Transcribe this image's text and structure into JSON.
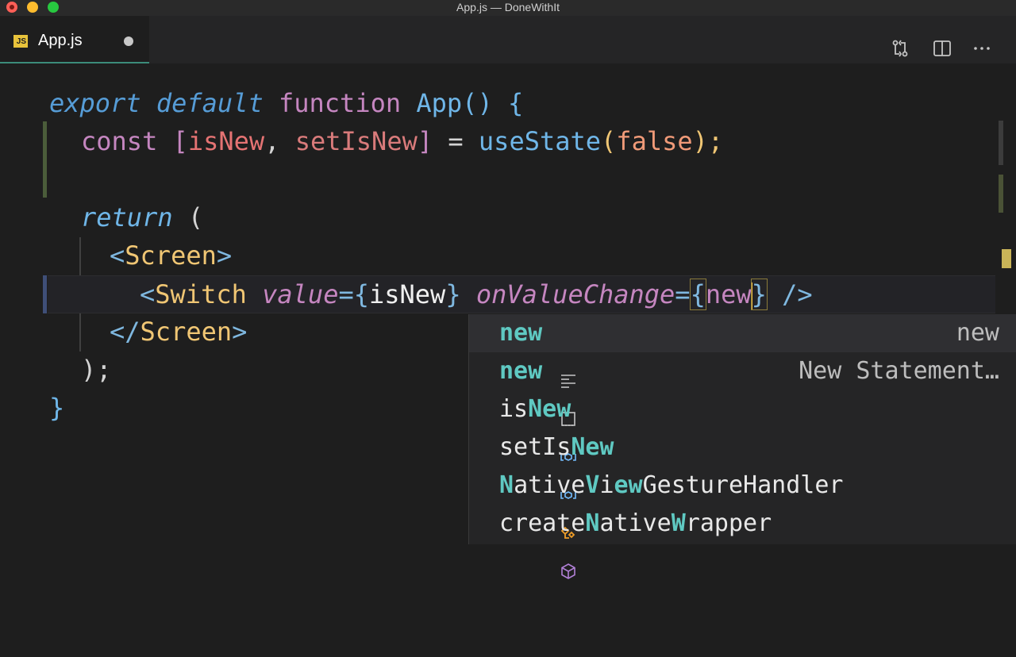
{
  "window": {
    "title": "App.js — DoneWithIt"
  },
  "tab": {
    "icon_label": "JS",
    "name": "App.js"
  },
  "toolbar_icons": [
    "source-control-compare-icon",
    "split-editor-icon",
    "more-actions-icon"
  ],
  "code": {
    "l1": {
      "export": "export",
      "default": "default",
      "function": "function",
      "name": "App",
      "rest": "() {"
    },
    "l2": {
      "const": "const",
      "open": "[",
      "a": "isNew",
      "comma": ", ",
      "b": "setIsNew",
      "close": "]",
      "eq": " = ",
      "call": "useState",
      "p1": "(",
      "val": "false",
      "p2": ");"
    },
    "l4": {
      "return": "return",
      "rest": " ("
    },
    "l5": {
      "lt": "<",
      "tag": "Screen",
      "gt": ">"
    },
    "l6": {
      "lt": "<",
      "tag": "Switch",
      "attr1": "value",
      "eq1": "=",
      "ob1": "{",
      "v1": "isNew",
      "cb1": "}",
      "attr2": "onValueChange",
      "eq2": "=",
      "ob2": "{",
      "v2": "new",
      "cb2": "}",
      "end": " />"
    },
    "l7": {
      "lt": "</",
      "tag": "Screen",
      "gt": ">"
    },
    "l8": {
      "text": ");"
    },
    "l9": {
      "text": "}"
    }
  },
  "suggestions": [
    {
      "icon": "snippet-text-icon",
      "pre": "",
      "match": "new",
      "post": "",
      "detail": "new"
    },
    {
      "icon": "snippet-icon",
      "pre": "",
      "match": "new",
      "post": "",
      "detail": "New Statement…"
    },
    {
      "icon": "variable-icon",
      "pre": "is",
      "match": "New",
      "post": "",
      "detail": ""
    },
    {
      "icon": "variable-icon",
      "pre": "setIs",
      "match": "New",
      "post": "",
      "detail": ""
    },
    {
      "icon": "class-icon",
      "label_parts": [
        "",
        "N",
        "ative",
        "V",
        "i",
        "ew",
        "GestureHandler"
      ]
    },
    {
      "icon": "module-icon",
      "label_parts": [
        "create",
        "N",
        "ative",
        "W",
        "rapper"
      ]
    }
  ],
  "colors": {
    "accent_tab": "#3c8c7a",
    "match": "#5fc9c2",
    "cursor": "#f6c343"
  }
}
